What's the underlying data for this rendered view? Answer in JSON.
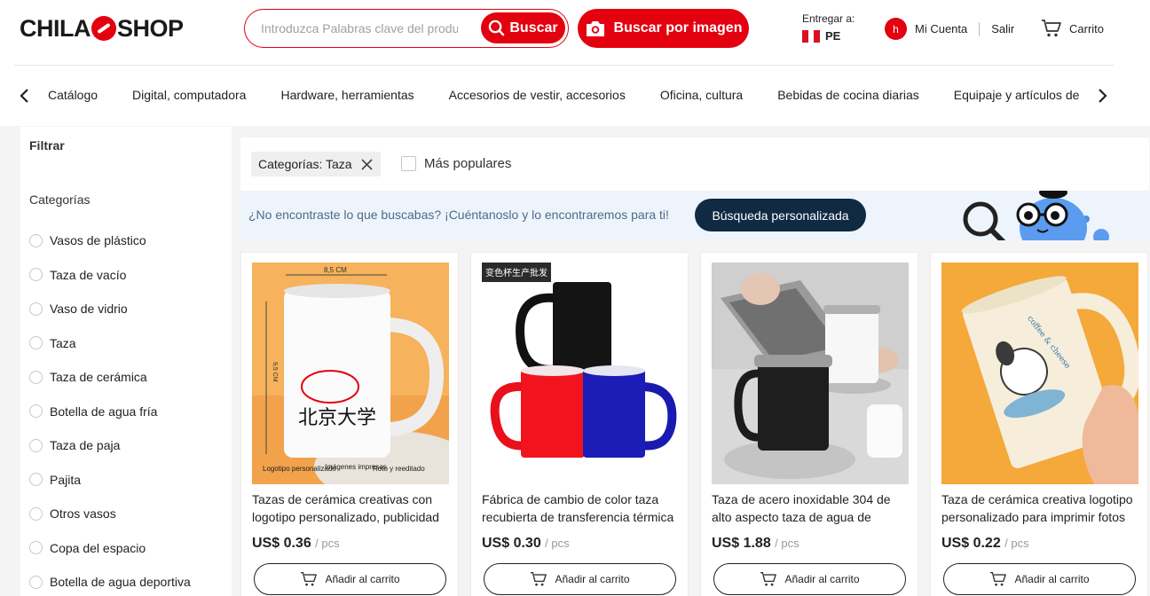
{
  "header": {
    "logo_left": "CHILA",
    "logo_right": "SHOP",
    "search_placeholder": "Introduzca Palabras clave del produ",
    "search_button": "Buscar",
    "image_search_button": "Buscar por imagen",
    "deliver_label": "Entregar a:",
    "country": "PE",
    "avatar_letter": "h",
    "account": "Mi Cuenta",
    "logout": "Salir",
    "cart": "Carrito"
  },
  "categories": [
    "Catálogo",
    "Digital, computadora",
    "Hardware, herramientas",
    "Accesorios de vestir, accesorios",
    "Oficina, cultura",
    "Bebidas de cocina diarias",
    "Equipaje y artículos de"
  ],
  "sidebar": {
    "filter_title": "Filtrar",
    "categories_title": "Categorías",
    "items": [
      "Vasos de plástico",
      "Taza de vacío",
      "Vaso de vidrio",
      "Taza",
      "Taza de cerámica",
      "Botella de agua fría",
      "Taza de paja",
      "Pajita",
      "Otros vasos",
      "Copa del espacio",
      "Botella de agua deportiva"
    ]
  },
  "filters": {
    "active_chip": "Categorías: Taza",
    "popular_label": "Más populares",
    "popular_checked": false
  },
  "banner": {
    "text": "¿No encontraste lo que buscabas? ¡Cuéntanoslo y lo encontraremos para ti!",
    "button": "Búsqueda personalizada"
  },
  "products": [
    {
      "title": "Tazas de cerámica creativas con logotipo personalizado, publicidad",
      "price": "US$ 0.36",
      "unit": "/ pcs",
      "add_to_cart": "Añadir al carrito",
      "image_texts": {
        "dimension": "8,5 CM",
        "height": "9,5 CM",
        "mug_text": "北京大学",
        "caption_1": "Logotipo personalizado",
        "caption_2": "Imágenes impresas",
        "caption_3": "Roto y reeditado"
      }
    },
    {
      "title": "Fábrica de cambio de color taza recubierta de transferencia térmica",
      "price": "US$ 0.30",
      "unit": "/ pcs",
      "add_to_cart": "Añadir al carrito",
      "image_texts": {
        "badge": "变色杯生产批发"
      }
    },
    {
      "title": "Taza de acero inoxidable 304 de alto aspecto taza de agua de",
      "price": "US$ 1.88",
      "unit": "/ pcs",
      "add_to_cart": "Añadir al carrito",
      "image_texts": {}
    },
    {
      "title": "Taza de cerámica creativa logotipo personalizado para imprimir fotos",
      "price": "US$ 0.22",
      "unit": "/ pcs",
      "add_to_cart": "Añadir al carrito",
      "image_texts": {
        "mug_text": "coffee & cheese"
      }
    }
  ],
  "colors": {
    "brand_red": "#e3000f",
    "dark_navy": "#0f2a42",
    "banner_bg": "#eef4fb",
    "page_bg": "#f4f4f4"
  },
  "icons": [
    "search-icon",
    "camera-icon",
    "cart-icon",
    "chevron-left-icon",
    "chevron-right-icon",
    "close-icon"
  ]
}
